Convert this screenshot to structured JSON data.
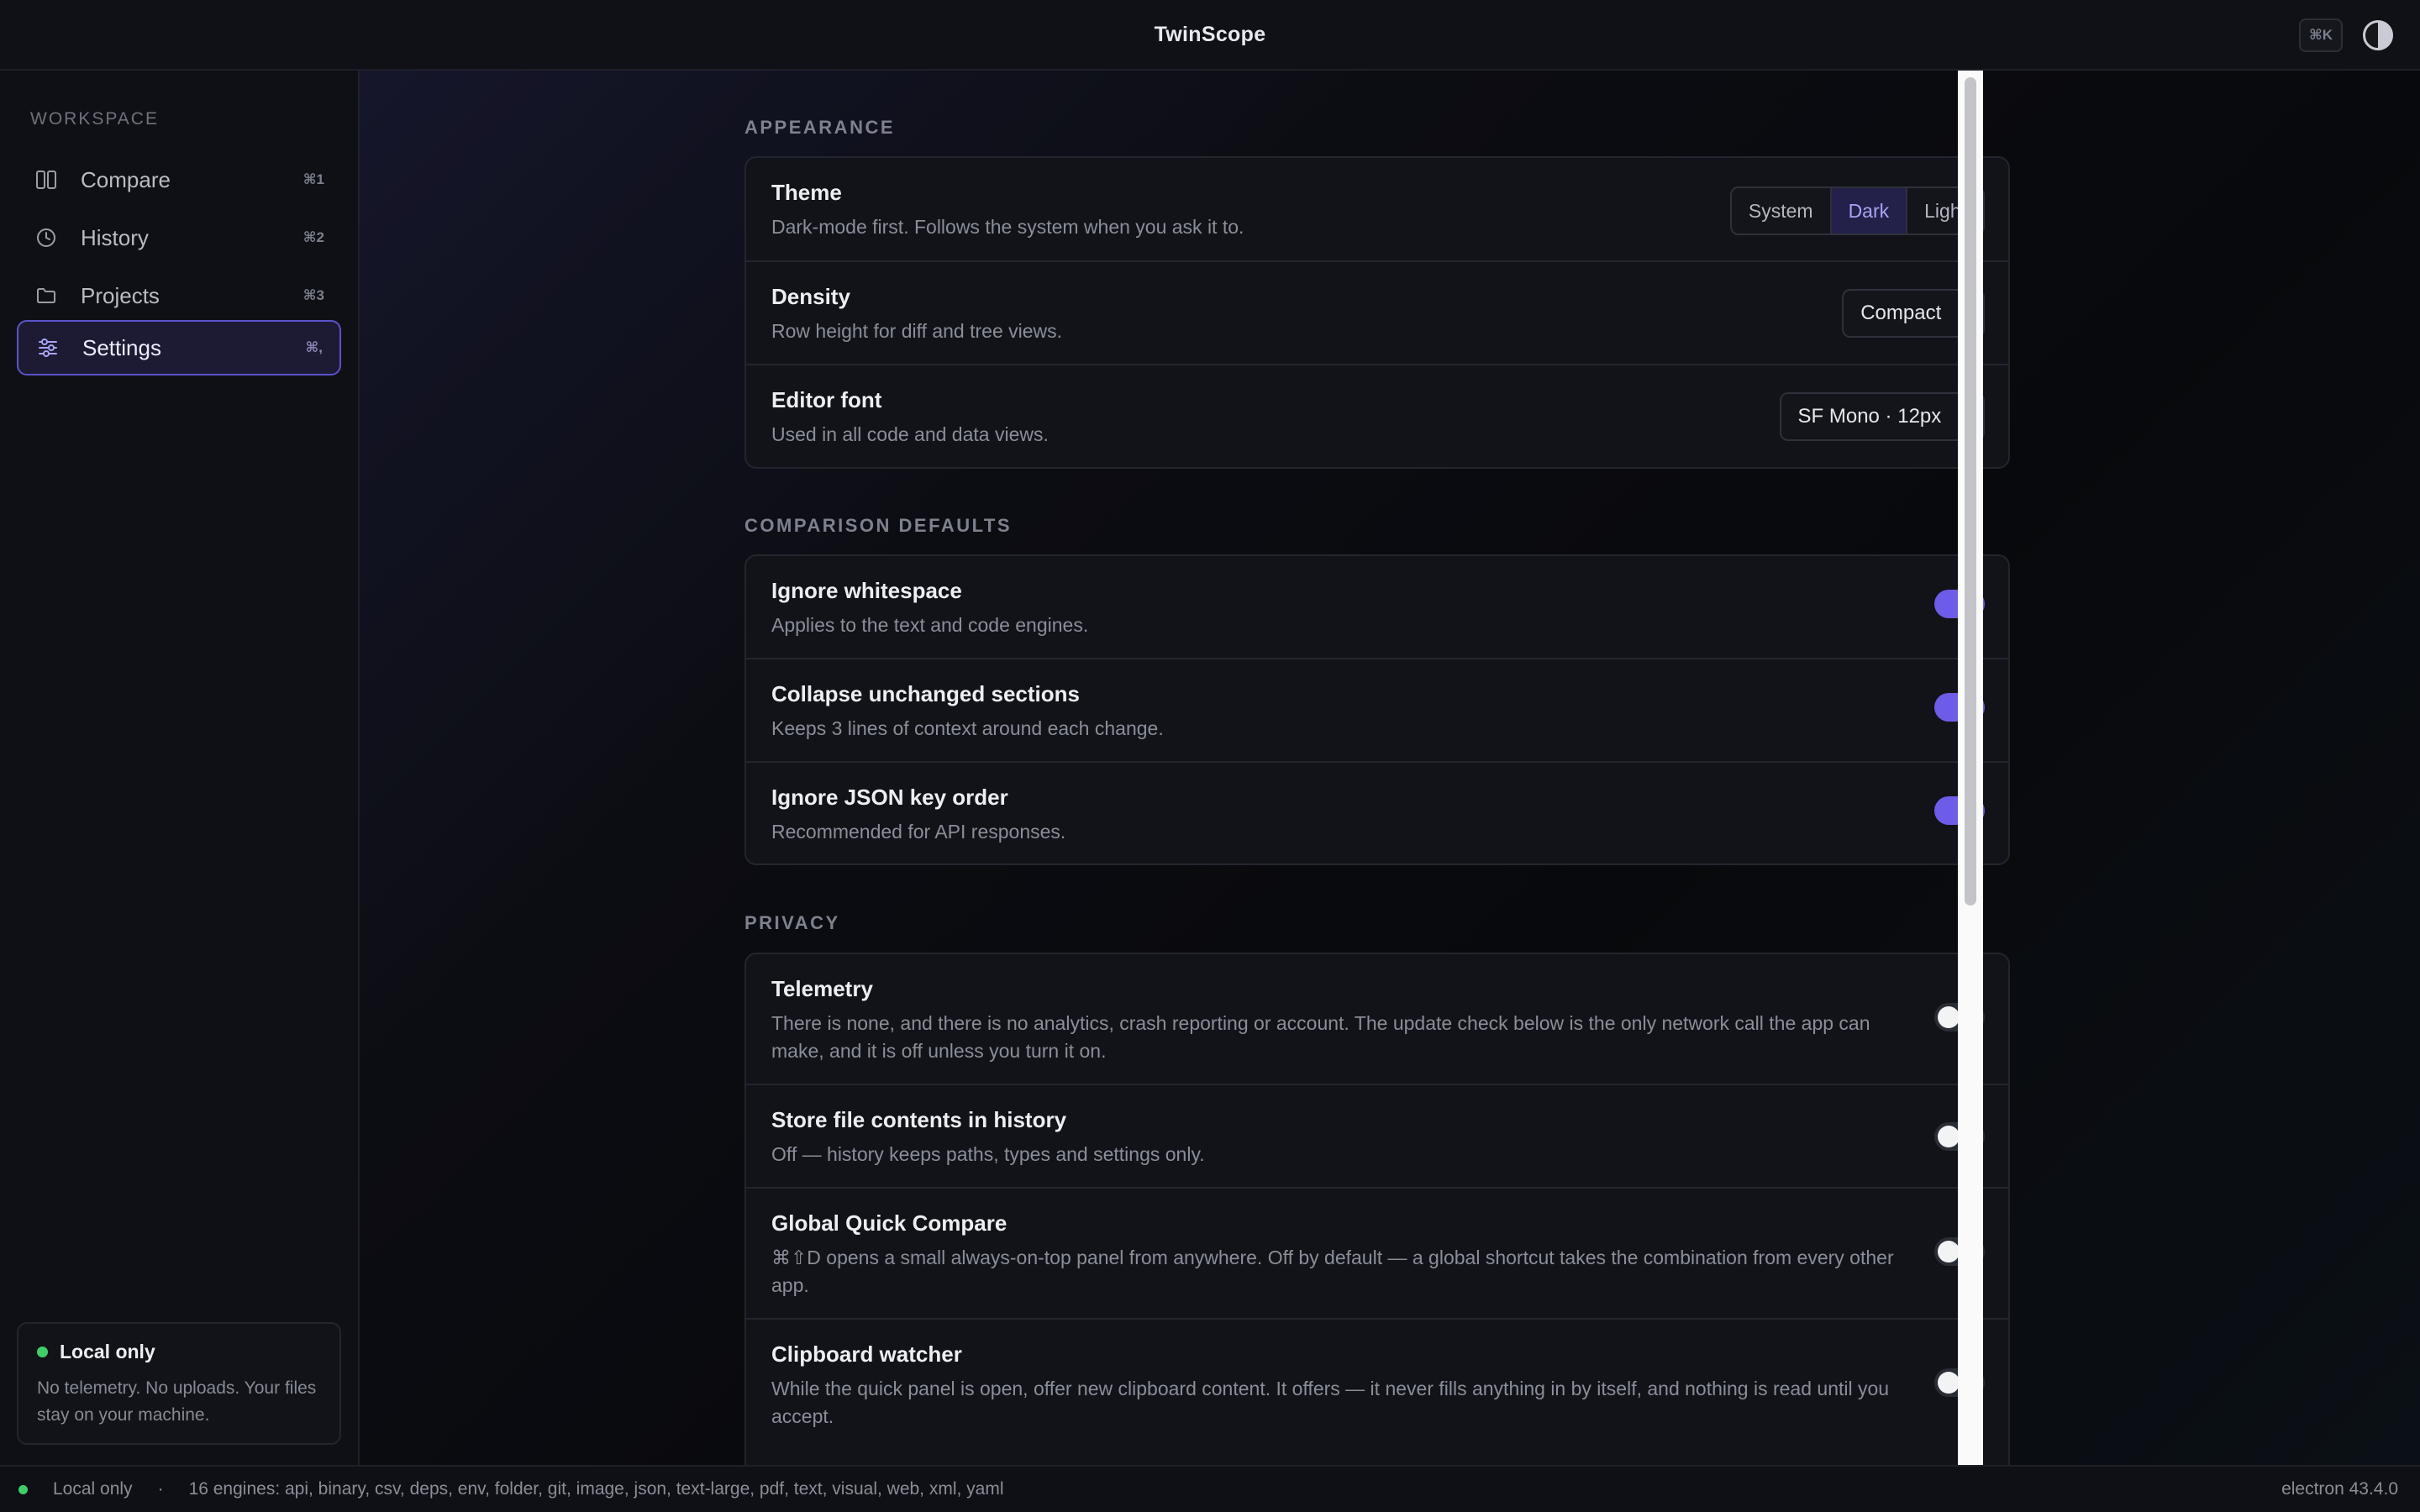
{
  "app": {
    "title": "TwinScope",
    "cmdk_label": "⌘K"
  },
  "sidebar": {
    "header": "WORKSPACE",
    "items": [
      {
        "label": "Compare",
        "shortcut": "⌘1",
        "icon": "columns-icon"
      },
      {
        "label": "History",
        "shortcut": "⌘2",
        "icon": "clock-icon"
      },
      {
        "label": "Projects",
        "shortcut": "⌘3",
        "icon": "folder-icon"
      },
      {
        "label": "Settings",
        "shortcut": "⌘,",
        "icon": "sliders-icon",
        "active": true
      }
    ],
    "local_card": {
      "title": "Local only",
      "text": "No telemetry. No uploads. Your files stay on your machine."
    }
  },
  "settings": {
    "appearance": {
      "section": "APPEARANCE",
      "theme": {
        "title": "Theme",
        "desc": "Dark-mode first. Follows the system when you ask it to.",
        "options": [
          "System",
          "Dark",
          "Light"
        ],
        "selected": "Dark"
      },
      "density": {
        "title": "Density",
        "desc": "Row height for diff and tree views.",
        "value": "Compact"
      },
      "editor_font": {
        "title": "Editor font",
        "desc": "Used in all code and data views.",
        "value": "SF Mono · 12px"
      }
    },
    "comparison": {
      "section": "COMPARISON DEFAULTS",
      "rows": [
        {
          "title": "Ignore whitespace",
          "desc": "Applies to the text and code engines.",
          "on": true
        },
        {
          "title": "Collapse unchanged sections",
          "desc": "Keeps 3 lines of context around each change.",
          "on": true
        },
        {
          "title": "Ignore JSON key order",
          "desc": "Recommended for API responses.",
          "on": true
        }
      ]
    },
    "privacy": {
      "section": "PRIVACY",
      "rows": [
        {
          "title": "Telemetry",
          "desc": "There is none, and there is no analytics, crash reporting or account. The update check below is the only network call the app can make, and it is off unless you turn it on.",
          "on": false
        },
        {
          "title": "Store file contents in history",
          "desc": "Off — history keeps paths, types and settings only.",
          "on": false
        },
        {
          "title": "Global Quick Compare",
          "desc": "⌘⇧D opens a small always-on-top panel from anywhere. Off by default — a global shortcut takes the combination from every other app.",
          "on": false
        },
        {
          "title": "Clipboard watcher",
          "desc": "While the quick panel is open, offer new clipboard content. It offers — it never fills anything in by itself, and nothing is read until you accept.",
          "on": false
        }
      ]
    }
  },
  "statusbar": {
    "status": "Local only",
    "separator": "·",
    "engines": "16 engines: api, binary, csv, deps, env, folder, git, image, json, text-large, pdf, text, visual, web, xml, yaml",
    "version": "electron 43.4.0"
  },
  "colors": {
    "accent": "#6c5ce7",
    "status_ok": "#3fcf6a"
  }
}
